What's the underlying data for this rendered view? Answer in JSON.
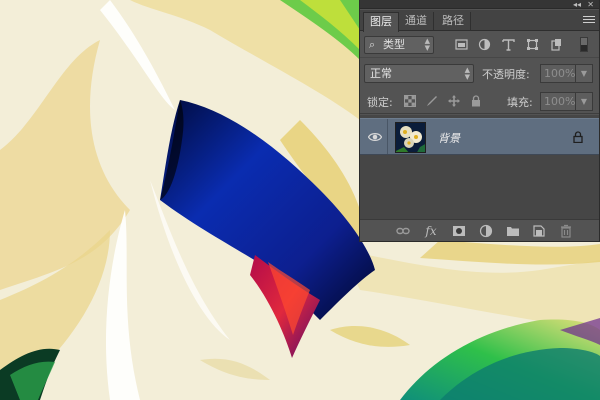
{
  "panel": {
    "tabs": [
      {
        "label": "图层",
        "active": true
      },
      {
        "label": "通道",
        "active": false
      },
      {
        "label": "路径",
        "active": false
      }
    ],
    "filter": {
      "label": "类型",
      "icons": [
        "image-filter-icon",
        "adjustment-filter-icon",
        "type-filter-icon",
        "shape-filter-icon",
        "smart-object-filter-icon"
      ]
    },
    "blend_mode": "正常",
    "opacity_label": "不透明度:",
    "opacity_value": "100%",
    "lock_label": "锁定:",
    "fill_label": "填充:",
    "fill_value": "100%",
    "layers": [
      {
        "name": "背景",
        "visible": true,
        "locked": true
      }
    ],
    "bottom_icons": [
      "link-layers-icon",
      "fx-icon",
      "add-mask-icon",
      "adjustment-layer-icon",
      "new-group-icon",
      "new-layer-icon",
      "delete-layer-icon"
    ],
    "fx_text": "fx"
  },
  "colors": {
    "panel_bg": "#535353",
    "selected_layer": "#5f6e80",
    "artwork_blue": "#0a1e9a",
    "artwork_cream": "#f1ebd2",
    "artwork_yellow": "#e8d98a"
  }
}
